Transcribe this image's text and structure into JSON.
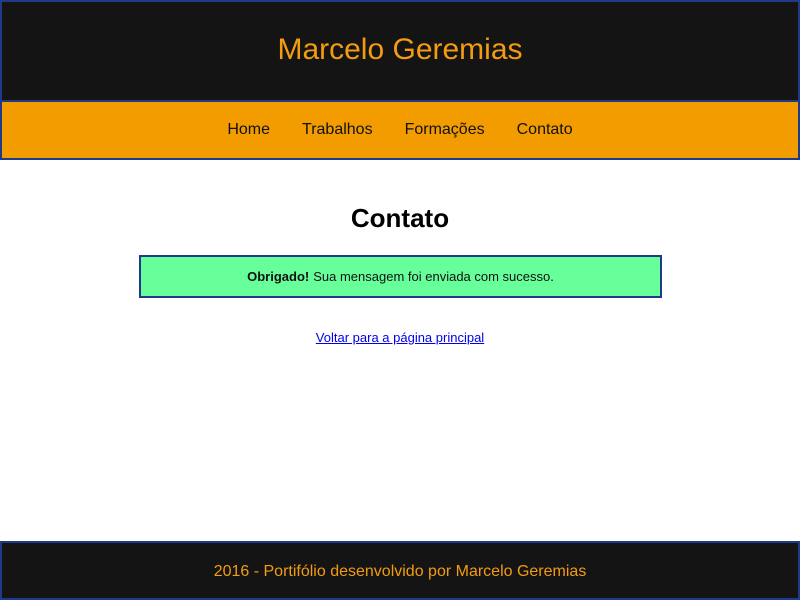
{
  "header": {
    "title": "Marcelo Geremias"
  },
  "nav": {
    "items": [
      {
        "label": "Home"
      },
      {
        "label": "Trabalhos"
      },
      {
        "label": "Formações"
      },
      {
        "label": "Contato"
      }
    ]
  },
  "main": {
    "title": "Contato",
    "alert": {
      "strong": "Obrigado!",
      "message": "Sua mensagem foi enviada com sucesso."
    },
    "back_link": "Voltar para a página principal"
  },
  "footer": {
    "text": "2016 - Portifólio desenvolvido por Marcelo Geremias"
  },
  "colors": {
    "header_bg": "#141414",
    "accent": "#f39c12",
    "nav_bg": "#f39c00",
    "border": "#1f3a8a",
    "success_bg": "#66ff99",
    "link": "#0000ee"
  }
}
